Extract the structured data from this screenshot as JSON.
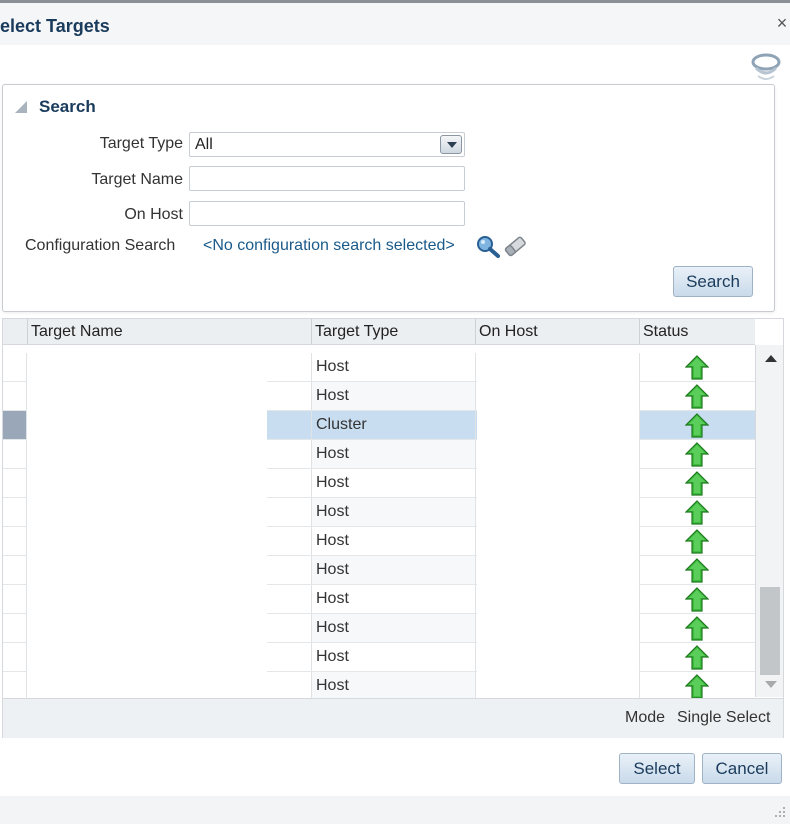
{
  "dialog": {
    "title": "elect Targets",
    "close_glyph": "×"
  },
  "search": {
    "header": "Search",
    "target_type_label": "Target Type",
    "target_type_value": "All",
    "target_name_label": "Target Name",
    "target_name_value": "",
    "on_host_label": "On Host",
    "on_host_value": "",
    "config_search_label": "Configuration Search",
    "config_search_value": "<No configuration search selected>",
    "search_button": "Search"
  },
  "table": {
    "columns": [
      "Target Name",
      "Target Type",
      "On Host",
      "Status"
    ],
    "rows": [
      {
        "type": "Host",
        "status": "up",
        "selected": false
      },
      {
        "type": "Host",
        "status": "up",
        "selected": false
      },
      {
        "type": "Cluster",
        "status": "up",
        "selected": true
      },
      {
        "type": "Host",
        "status": "up",
        "selected": false
      },
      {
        "type": "Host",
        "status": "up",
        "selected": false
      },
      {
        "type": "Host",
        "status": "up",
        "selected": false
      },
      {
        "type": "Host",
        "status": "up",
        "selected": false
      },
      {
        "type": "Host",
        "status": "up",
        "selected": false
      },
      {
        "type": "Host",
        "status": "up",
        "selected": false
      },
      {
        "type": "Host",
        "status": "up",
        "selected": false
      },
      {
        "type": "Host",
        "status": "up",
        "selected": false
      },
      {
        "type": "Host",
        "status": "up",
        "selected": false
      }
    ],
    "mode_label": "Mode",
    "mode_value": "Single Select"
  },
  "actions": {
    "select_button": "Select",
    "cancel_button": "Cancel"
  },
  "icons": {
    "status_up": "green-up-arrow-icon",
    "magnifier": "search-icon",
    "eraser": "clear-icon"
  },
  "colors": {
    "selection": "#c9ddf1",
    "status_up": "#2e9e2e",
    "title": "#1a3b5c"
  }
}
